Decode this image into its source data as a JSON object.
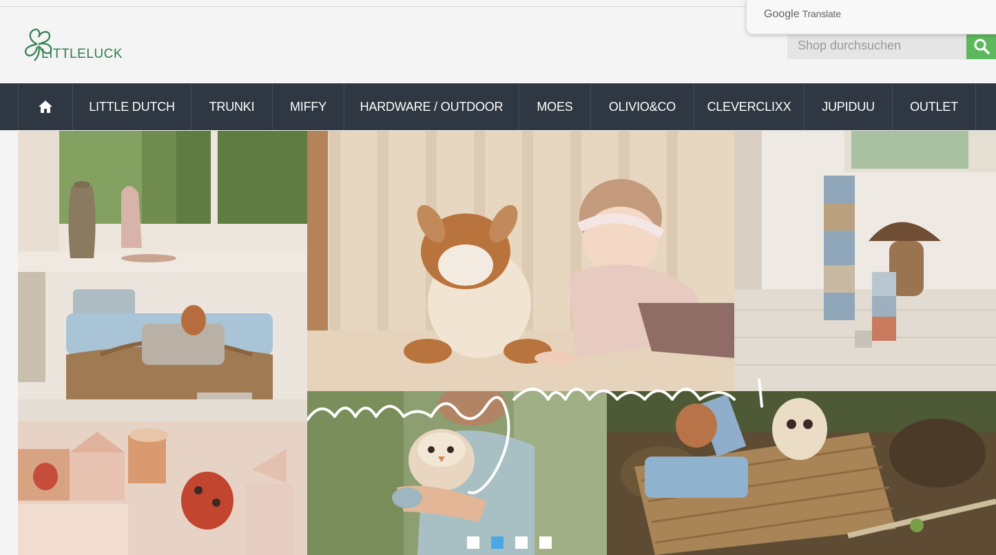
{
  "google_translate": {
    "brand_google": "Google",
    "brand_translate": "Translate"
  },
  "logo": {
    "text_first": "Little",
    "text_second": "Luck"
  },
  "search": {
    "placeholder": "Shop durchsuchen",
    "value": ""
  },
  "nav": {
    "home_icon": "home-icon",
    "items": [
      {
        "label": "LITTLE DUTCH"
      },
      {
        "label": "TRUNKI"
      },
      {
        "label": "MIFFY"
      },
      {
        "label": "HARDWARE / OUTDOOR"
      },
      {
        "label": "MOES"
      },
      {
        "label": "OLIVIO&CO"
      },
      {
        "label": "CLEVERCLIXX"
      },
      {
        "label": "JUPIDUU"
      },
      {
        "label": "OUTLET"
      }
    ]
  },
  "hero": {
    "script_text": "magic moments...",
    "slide_count": 4,
    "active_slide": 2
  },
  "colors": {
    "nav_bg": "#2f3742",
    "search_button": "#5cb85c",
    "brand_green": "#2e7d4f",
    "active_dot": "#4aa8e6"
  }
}
